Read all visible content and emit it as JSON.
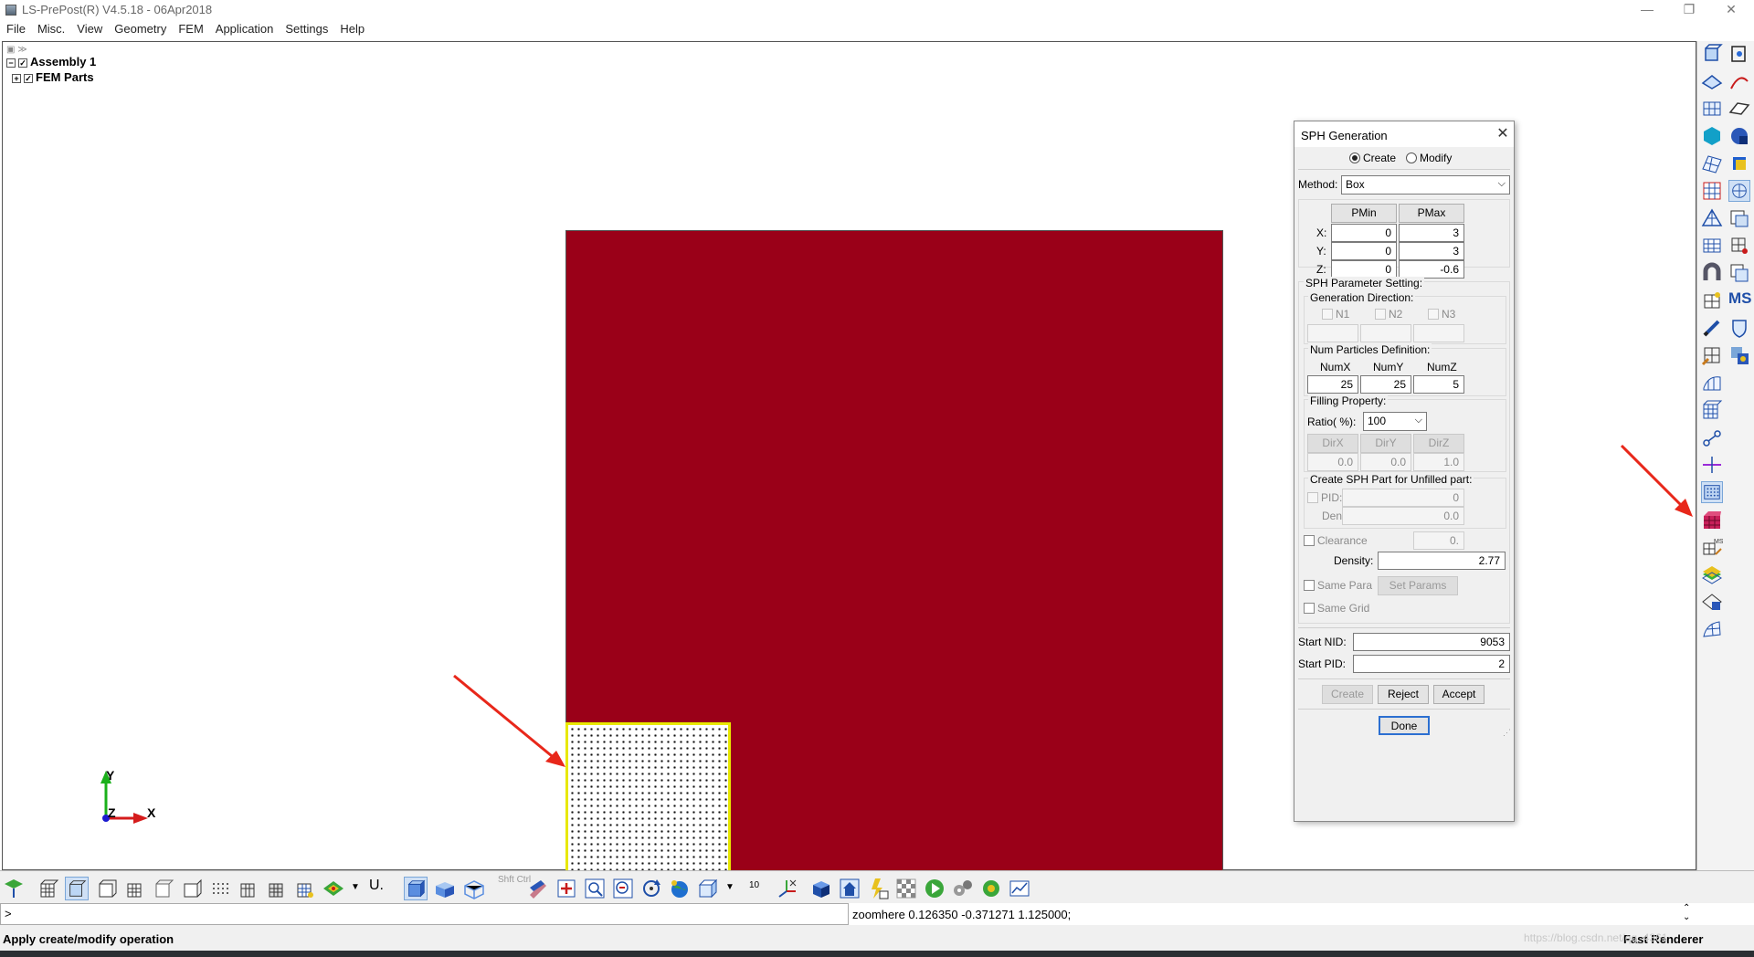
{
  "window": {
    "title": "LS-PrePost(R) V4.5.18 - 06Apr2018"
  },
  "menu": [
    "File",
    "Misc.",
    "View",
    "Geometry",
    "FEM",
    "Application",
    "Settings",
    "Help"
  ],
  "tree": {
    "assembly": "Assembly 1",
    "parts": "FEM Parts"
  },
  "axes": {
    "y": "Y",
    "x": "X",
    "z": "Z"
  },
  "dialog": {
    "title": "SPH Generation",
    "mode_create": "Create",
    "mode_modify": "Modify",
    "method_label": "Method:",
    "method_value": "Box",
    "pmin": "PMin",
    "pmax": "PMax",
    "x_label": "X:",
    "y_label": "Y:",
    "z_label": "Z:",
    "xmin": "0",
    "xmax": "3",
    "ymin": "0",
    "ymax": "3",
    "zmin": "0",
    "zmax": "-0.6",
    "param_group": "SPH Parameter Setting:",
    "gen_dir": "Generation Direction:",
    "n1": "N1",
    "n2": "N2",
    "n3": "N3",
    "num_particles": "Num Particles Definition:",
    "numx_label": "NumX",
    "numy_label": "NumY",
    "numz_label": "NumZ",
    "numx": "25",
    "numy": "25",
    "numz": "5",
    "filling": "Filling Property:",
    "ratio_label": "Ratio( %):",
    "ratio_value": "100",
    "dirx": "DirX",
    "diry": "DirY",
    "dirz": "DirZ",
    "dirx_v": "0.0",
    "diry_v": "0.0",
    "dirz_v": "1.0",
    "unfilled": "Create SPH Part for Unfilled part:",
    "pid_label": "PID:",
    "pid_value": "0",
    "den_label": "Den:",
    "den_value": "0.0",
    "clearance_label": "Clearance",
    "clearance_value": "0.",
    "density_label": "Density:",
    "density_value": "2.77",
    "same_para": "Same Para",
    "set_params": "Set Params",
    "same_grid": "Same Grid",
    "start_nid_label": "Start NID:",
    "start_nid": "9053",
    "start_pid_label": "Start PID:",
    "start_pid": "2",
    "create_btn": "Create",
    "reject_btn": "Reject",
    "accept_btn": "Accept",
    "done_btn": "Done"
  },
  "command": {
    "prompt": ">",
    "output": "zoomhere 0.126350 -0.371271 1.125000;"
  },
  "status": {
    "left": "Apply create/modify operation",
    "right": "Fast Renderer"
  },
  "toolbar": {
    "shift_ctrl": "Shft Ctrl",
    "ten": "10"
  },
  "watermark": "https://blog.csdn.net/qq_4361",
  "colors": {
    "part": "#9a0018",
    "sph_outline": "#e8e800",
    "arrow": "#e8271a"
  }
}
